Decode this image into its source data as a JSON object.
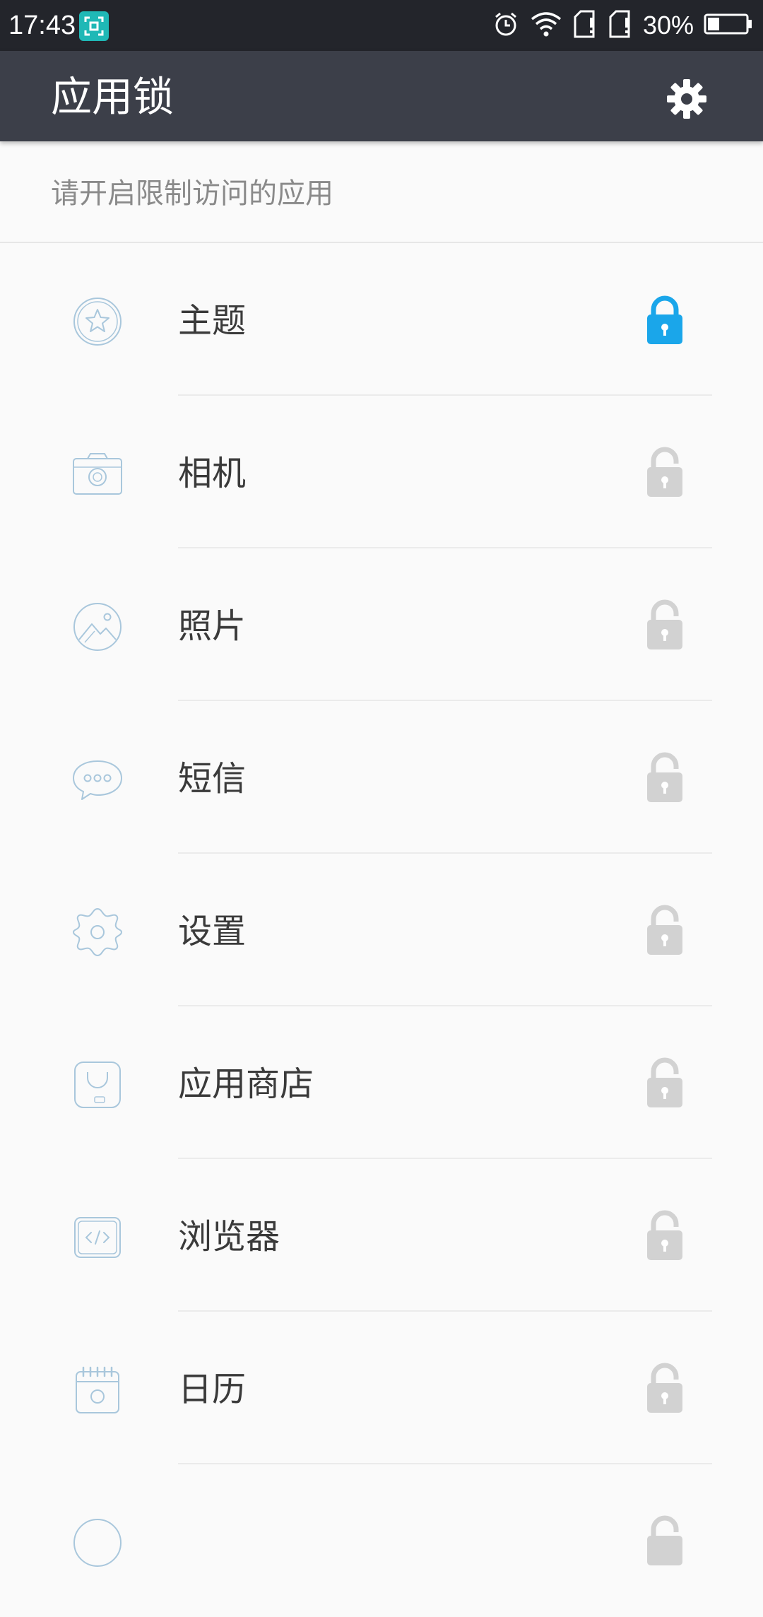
{
  "status_bar": {
    "time": "17:43",
    "battery_percent": "30%",
    "battery_level": 0.3,
    "icons": [
      "screenshot-app-icon",
      "alarm-icon",
      "wifi-icon",
      "sim1-icon",
      "sim2-icon",
      "battery-icon"
    ]
  },
  "app_bar": {
    "title": "应用锁",
    "settings_icon": "gear-icon"
  },
  "subtitle": "请开启限制访问的应用",
  "colors": {
    "status_bar": "#23252b",
    "app_bar": "#3c3f49",
    "lock_on": "#1aa6ea",
    "lock_off": "#d2d2d2",
    "icon_outline": "#a9c7dc"
  },
  "apps": [
    {
      "label": "主题",
      "icon": "theme-star-icon",
      "locked": true
    },
    {
      "label": "相机",
      "icon": "camera-icon",
      "locked": false
    },
    {
      "label": "照片",
      "icon": "photos-icon",
      "locked": false
    },
    {
      "label": "短信",
      "icon": "messages-icon",
      "locked": false
    },
    {
      "label": "设置",
      "icon": "settings-gear-icon",
      "locked": false
    },
    {
      "label": "应用商店",
      "icon": "app-store-bag-icon",
      "locked": false
    },
    {
      "label": "浏览器",
      "icon": "browser-code-icon",
      "locked": false
    },
    {
      "label": "日历",
      "icon": "calendar-icon",
      "locked": false
    }
  ]
}
